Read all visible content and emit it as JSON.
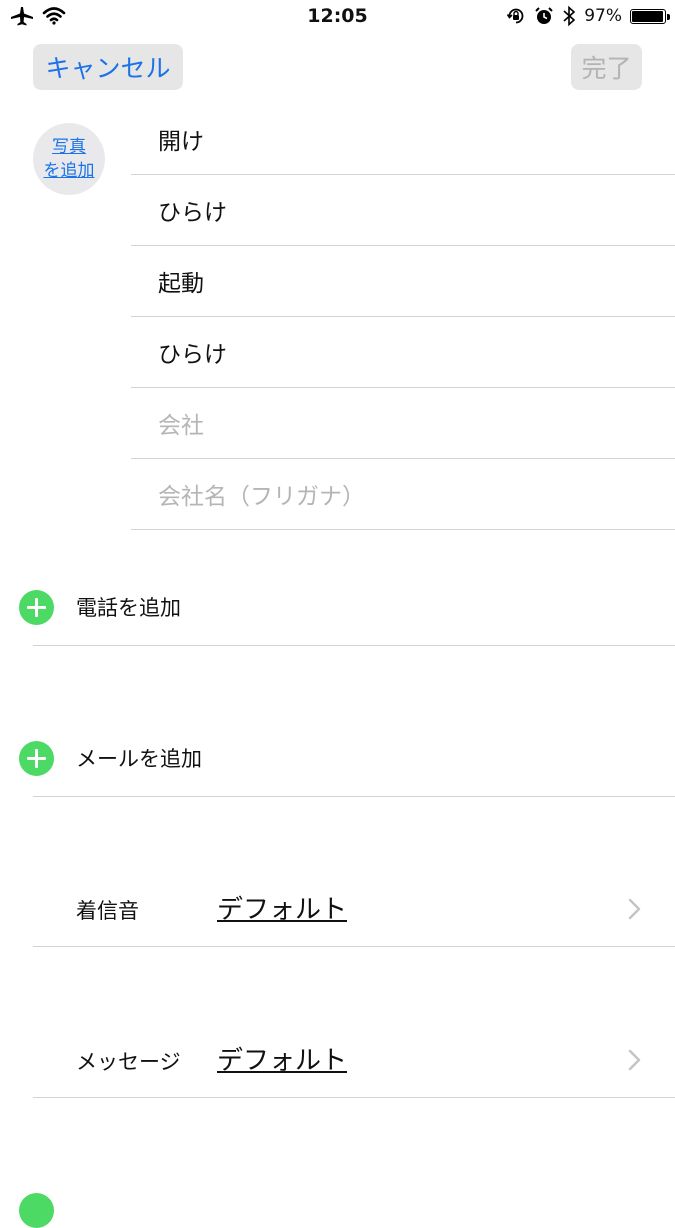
{
  "status_bar": {
    "time": "12:05",
    "battery_text": "97%",
    "battery_level": 0.97,
    "icons": [
      "airplane-icon",
      "wifi-icon",
      "orientation-lock-icon",
      "alarm-icon",
      "bluetooth-icon",
      "battery-icon"
    ]
  },
  "nav": {
    "cancel_label": "キャンセル",
    "done_label": "完了"
  },
  "photo": {
    "line1": "写真",
    "line2": "を追加"
  },
  "name_fields": [
    {
      "value": "開け",
      "placeholder": false
    },
    {
      "value": "ひらけ",
      "placeholder": false
    },
    {
      "value": "起動",
      "placeholder": false
    },
    {
      "value": "ひらけ",
      "placeholder": false
    },
    {
      "value": "会社",
      "placeholder": true
    },
    {
      "value": "会社名（フリガナ）",
      "placeholder": true
    }
  ],
  "add_phone": {
    "label": "電話を追加"
  },
  "add_email": {
    "label": "メールを追加"
  },
  "ringtone": {
    "label": "着信音",
    "value": "デフォルト"
  },
  "message_tone": {
    "label": "メッセージ",
    "value": "デフォルト"
  },
  "colors": {
    "accent": "#1a73e8",
    "add_green": "#4cd964",
    "placeholder": "#b5b5b5",
    "divider": "#d3d3d3"
  }
}
